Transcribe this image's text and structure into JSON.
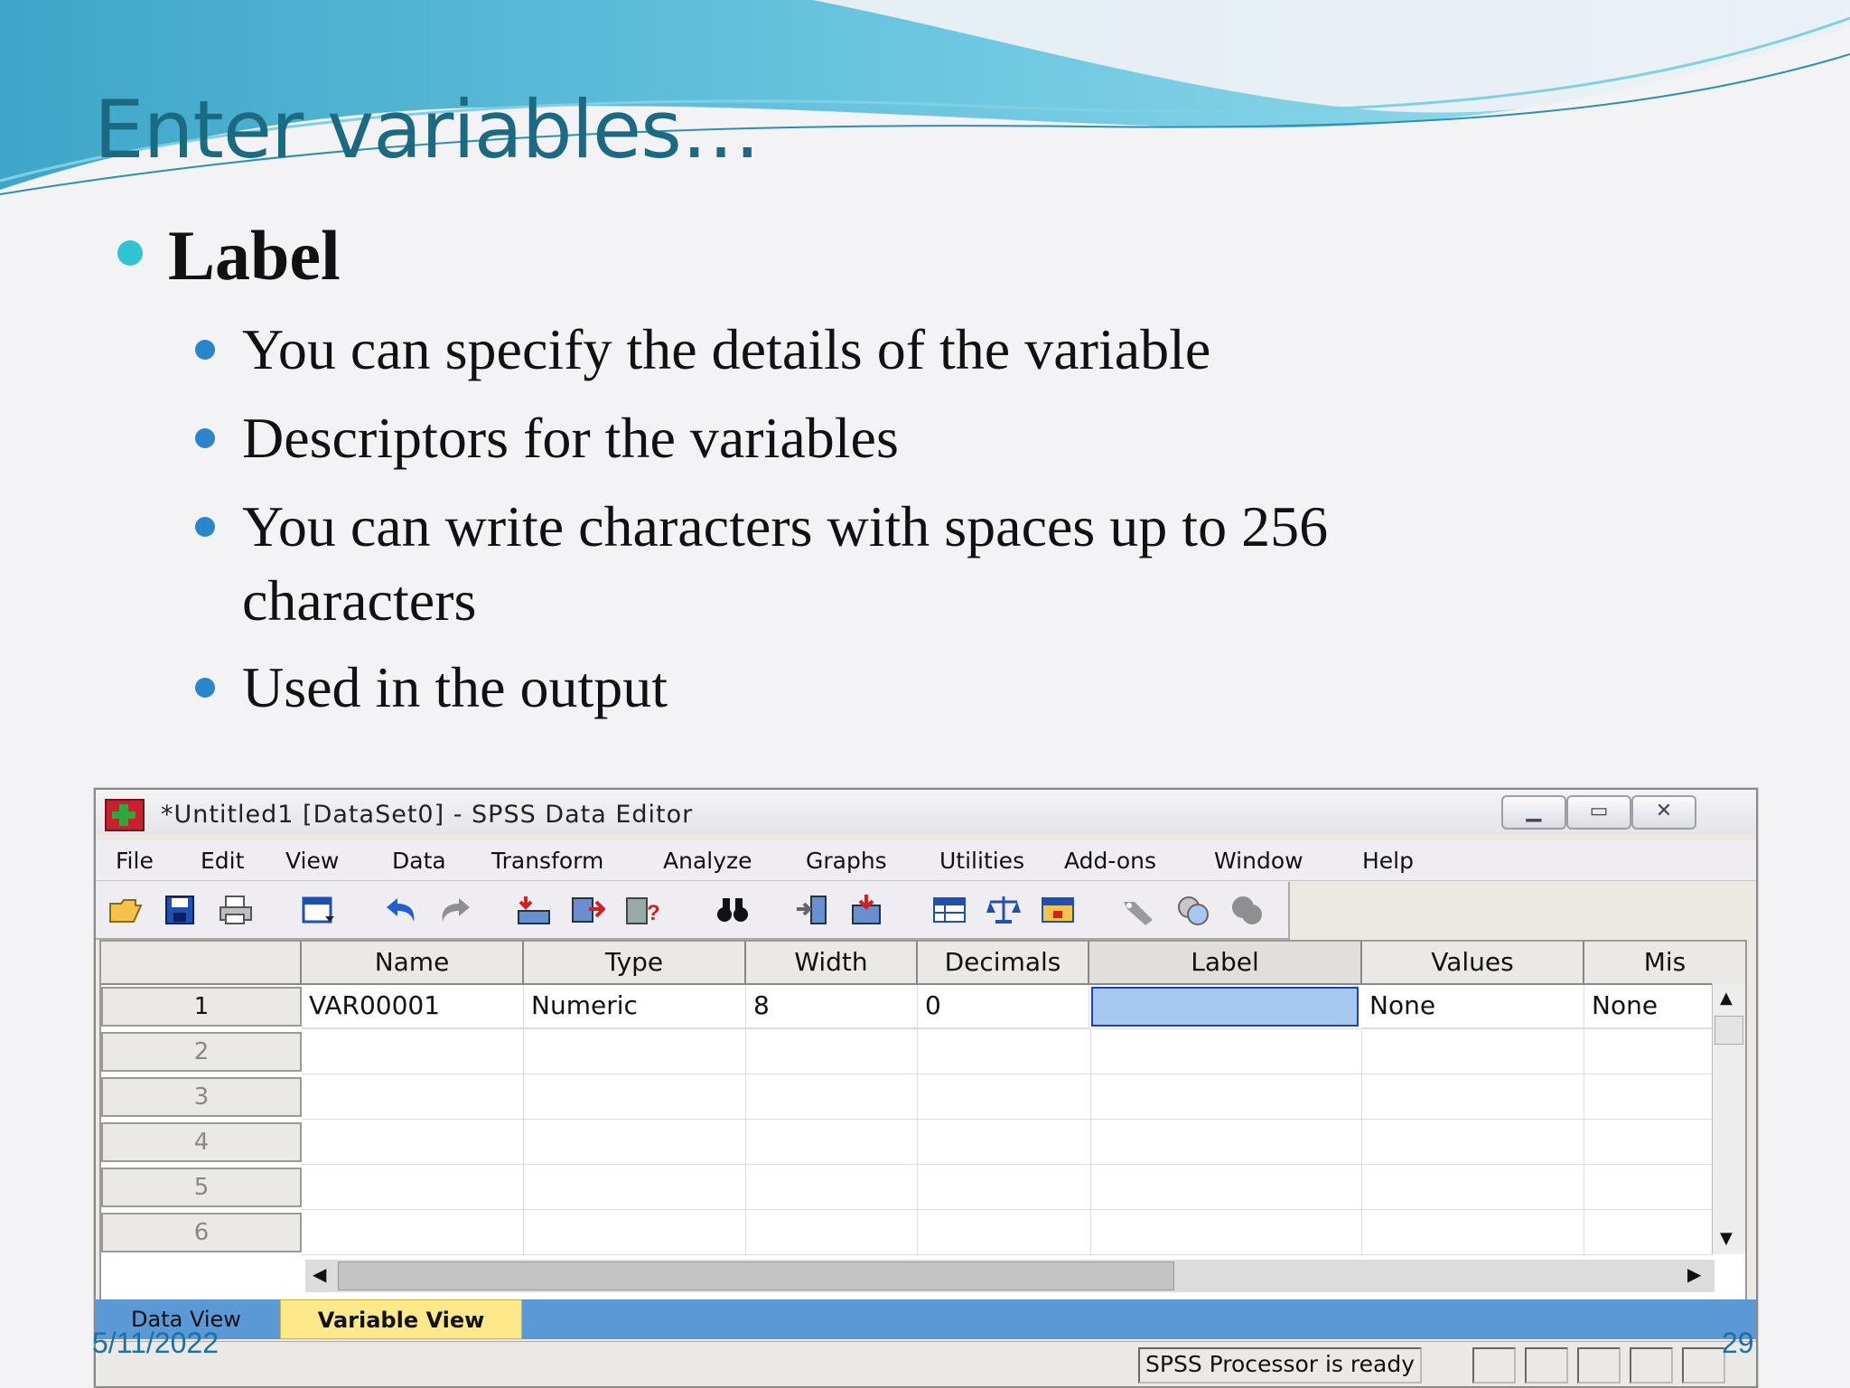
{
  "slide": {
    "title": "Enter variables…",
    "bullet": "Label",
    "sub_bullets": [
      "You can specify the details of the variable",
      "Descriptors for the variables",
      "You can write characters with spaces up to 256",
      "characters",
      "Used in the output"
    ],
    "date": "5/11/2022",
    "page_number": "29"
  },
  "window": {
    "title": "*Untitled1 [DataSet0] - SPSS Data Editor",
    "controls": [
      "minimize",
      "maximize",
      "close"
    ]
  },
  "menubar": [
    "File",
    "Edit",
    "View",
    "Data",
    "Transform",
    "Analyze",
    "Graphs",
    "Utilities",
    "Add-ons",
    "Window",
    "Help"
  ],
  "toolbar_icons": [
    "open-folder-icon",
    "save-icon",
    "print-icon",
    "dialog-recall-icon",
    "undo-icon",
    "redo-icon",
    "goto-case-icon",
    "insert-case-icon",
    "variables-icon",
    "find-icon",
    "insert-variable-icon",
    "split-file-icon",
    "select-cases-icon",
    "weight-cases-icon",
    "value-labels-icon",
    "use-sets-icon",
    "show-all-icon",
    "spell-icon"
  ],
  "grid": {
    "columns": [
      "Name",
      "Type",
      "Width",
      "Decimals",
      "Label",
      "Values",
      "Mis"
    ],
    "row_numbers": [
      "1",
      "2",
      "3",
      "4",
      "5",
      "6"
    ],
    "rows": [
      [
        "VAR00001",
        "Numeric",
        "8",
        "0",
        "",
        "None",
        "None"
      ]
    ]
  },
  "tabs": {
    "data_view": "Data View",
    "variable_view": "Variable View",
    "active": "Variable View"
  },
  "status": "SPSS  Processor is ready",
  "colors": {
    "title": "#1b6a82",
    "selected_cell": "#a6c8ee",
    "active_tab": "#fde98a",
    "tab_bar": "#5a99d6"
  }
}
